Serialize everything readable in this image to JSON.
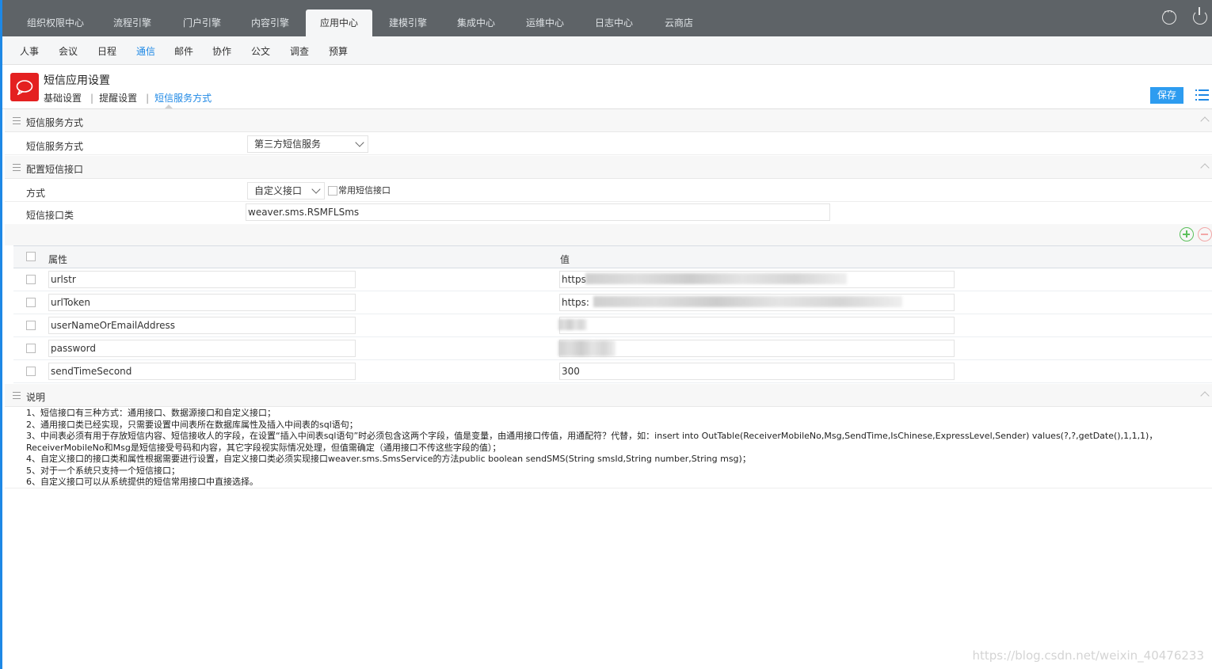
{
  "top_nav": {
    "tabs": [
      "组织权限中心",
      "流程引擎",
      "门户引擎",
      "内容引擎",
      "应用中心",
      "建模引擎",
      "集成中心",
      "运维中心",
      "日志中心",
      "云商店"
    ],
    "active_index": 4
  },
  "sub_nav": {
    "items": [
      "人事",
      "会议",
      "日程",
      "通信",
      "邮件",
      "协作",
      "公文",
      "调查",
      "预算"
    ],
    "active_index": 3
  },
  "header": {
    "title": "短信应用设置",
    "breadcrumbs": [
      "基础设置",
      "提醒设置",
      "短信服务方式"
    ],
    "save_label": "保存"
  },
  "section_service": {
    "title": "短信服务方式",
    "row_label": "短信服务方式",
    "selected": "第三方短信服务"
  },
  "section_config": {
    "title": "配置短信接口",
    "mode_label": "方式",
    "mode_selected": "自定义接口",
    "common_checkbox_label": "常用短信接口",
    "class_label": "短信接口类",
    "class_value": "weaver.sms.RSMFLSms"
  },
  "table": {
    "headers": [
      "属性",
      "值"
    ],
    "rows": [
      {
        "attr": "urlstr",
        "value": "https"
      },
      {
        "attr": "urlToken",
        "value": "https:"
      },
      {
        "attr": "userNameOrEmailAddress",
        "value": ""
      },
      {
        "attr": "password",
        "value": ""
      },
      {
        "attr": "sendTimeSecond",
        "value": "300"
      }
    ]
  },
  "section_notes": {
    "title": "说明",
    "lines": [
      "1、短信接口有三种方式：通用接口、数据源接口和自定义接口；",
      "2、通用接口类已经实现，只需要设置中间表所在数据库属性及插入中间表的sql语句；",
      "3、中间表必须有用于存放短信内容、短信接收人的字段，在设置“插入中间表sql语句”时必须包含这两个字段，值是变量，由通用接口传值，用通配符？代替，如：insert into OutTable(ReceiverMobileNo,Msg,SendTime,IsChinese,ExpressLevel,Sender) values(?,?,getDate(),1,1,1)，ReceiverMobileNo和Msg是短信接受号码和内容，其它字段视实际情况处理，但值需确定（通用接口不传这些字段的值）；",
      "4、自定义接口的接口类和属性根据需要进行设置，自定义接口类必须实现接口weaver.sms.SmsService的方法public boolean sendSMS(String smsId,String number,String msg)；",
      "5、对于一个系统只支持一个短信接口；",
      "6、自定义接口可以从系统提供的短信常用接口中直接选择。"
    ]
  },
  "watermark": "https://blog.csdn.net/weixin_40476233",
  "colors": {
    "accent": "#1e88e5",
    "topbar": "#5e6367",
    "app_icon": "#e42020",
    "save_button": "#2d9cf0"
  }
}
